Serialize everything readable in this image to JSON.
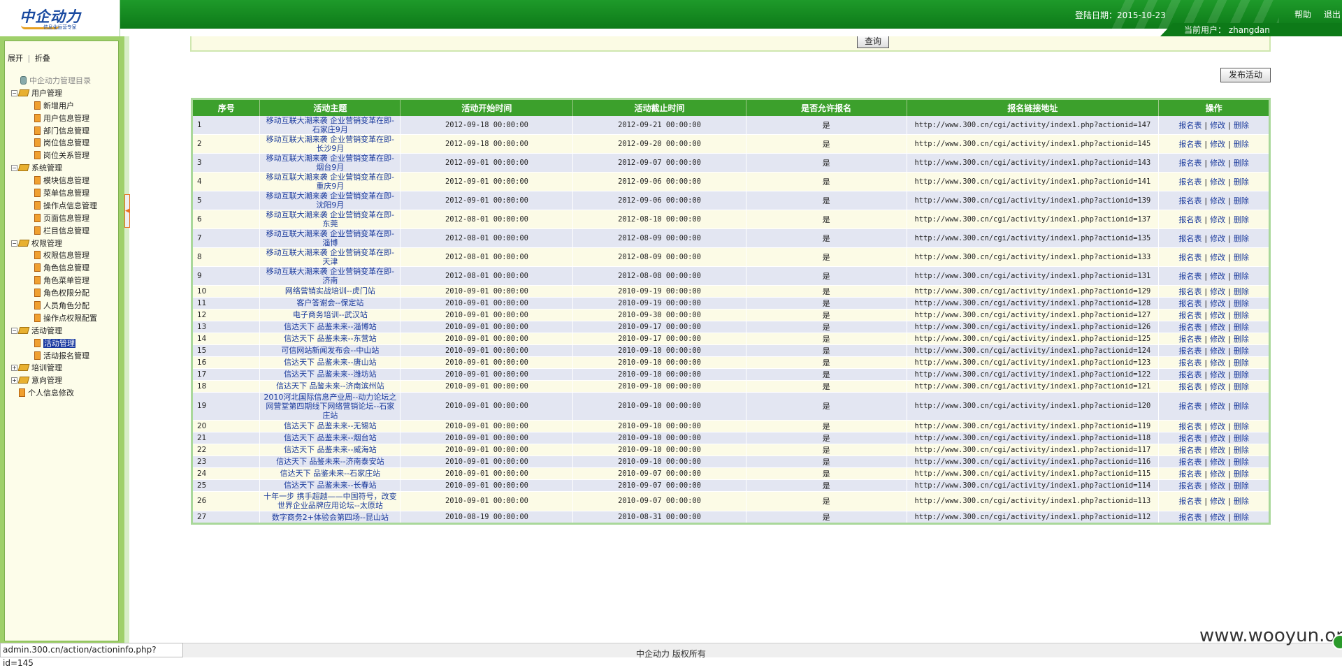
{
  "header": {
    "logo_text": "中企动力",
    "logo_sub": "信息化运营专家",
    "login_date": "登陆日期：2015-10-23",
    "current_user": "当前用户： zhangdan",
    "help": "帮助",
    "logout": "退出"
  },
  "sidebar": {
    "expand": "展开",
    "separator": "|",
    "collapse": "折叠",
    "root": "中企动力管理目录",
    "groups": [
      {
        "label": "用户管理",
        "items": [
          "新增用户",
          "用户信息管理",
          "部门信息管理",
          "岗位信息管理",
          "岗位关系管理"
        ]
      },
      {
        "label": "系统管理",
        "items": [
          "模块信息管理",
          "菜单信息管理",
          "操作点信息管理",
          "页面信息管理",
          "栏目信息管理"
        ]
      },
      {
        "label": "权限管理",
        "items": [
          "权限信息管理",
          "角色信息管理",
          "角色菜单管理",
          "角色权限分配",
          "人员角色分配",
          "操作点权限配置"
        ]
      },
      {
        "label": "活动管理",
        "items": [
          "活动管理",
          "活动报名管理"
        ]
      },
      {
        "label": "培训管理",
        "items": []
      },
      {
        "label": "意向管理",
        "items": []
      }
    ],
    "personal": "个人信息修改",
    "selected": "活动管理"
  },
  "toolbar": {
    "query": "查询",
    "publish": "发布活动"
  },
  "table": {
    "headers": [
      "序号",
      "活动主题",
      "活动开始时间",
      "活动截止时间",
      "是否允许报名",
      "报名链接地址",
      "操作"
    ],
    "op_labels": {
      "signup": "报名表",
      "edit": "修改",
      "delete": "删除",
      "sep": "|"
    },
    "rows": [
      {
        "seq": "1",
        "topic": "移动互联大潮来袭 企业营销变革在即-石家庄9月",
        "start": "2012-09-18 00:00:00",
        "end": "2012-09-21 00:00:00",
        "allow": "是",
        "url": "http://www.300.cn/cgi/activity/index1.php?actionid=147"
      },
      {
        "seq": "2",
        "topic": "移动互联大潮来袭 企业营销变革在即-长沙9月",
        "start": "2012-09-18 00:00:00",
        "end": "2012-09-20 00:00:00",
        "allow": "是",
        "url": "http://www.300.cn/cgi/activity/index1.php?actionid=145"
      },
      {
        "seq": "3",
        "topic": "移动互联大潮来袭 企业营销变革在即-烟台9月",
        "start": "2012-09-01 00:00:00",
        "end": "2012-09-07 00:00:00",
        "allow": "是",
        "url": "http://www.300.cn/cgi/activity/index1.php?actionid=143"
      },
      {
        "seq": "4",
        "topic": "移动互联大潮来袭 企业营销变革在即-重庆9月",
        "start": "2012-09-01 00:00:00",
        "end": "2012-09-06 00:00:00",
        "allow": "是",
        "url": "http://www.300.cn/cgi/activity/index1.php?actionid=141"
      },
      {
        "seq": "5",
        "topic": "移动互联大潮来袭 企业营销变革在即-沈阳9月",
        "start": "2012-09-01 00:00:00",
        "end": "2012-09-06 00:00:00",
        "allow": "是",
        "url": "http://www.300.cn/cgi/activity/index1.php?actionid=139"
      },
      {
        "seq": "6",
        "topic": "移动互联大潮来袭 企业营销变革在即-东莞",
        "start": "2012-08-01 00:00:00",
        "end": "2012-08-10 00:00:00",
        "allow": "是",
        "url": "http://www.300.cn/cgi/activity/index1.php?actionid=137"
      },
      {
        "seq": "7",
        "topic": "移动互联大潮来袭 企业营销变革在即-淄博",
        "start": "2012-08-01 00:00:00",
        "end": "2012-08-09 00:00:00",
        "allow": "是",
        "url": "http://www.300.cn/cgi/activity/index1.php?actionid=135"
      },
      {
        "seq": "8",
        "topic": "移动互联大潮来袭 企业营销变革在即-天津",
        "start": "2012-08-01 00:00:00",
        "end": "2012-08-09 00:00:00",
        "allow": "是",
        "url": "http://www.300.cn/cgi/activity/index1.php?actionid=133"
      },
      {
        "seq": "9",
        "topic": "移动互联大潮来袭 企业营销变革在即-济南",
        "start": "2012-08-01 00:00:00",
        "end": "2012-08-08 00:00:00",
        "allow": "是",
        "url": "http://www.300.cn/cgi/activity/index1.php?actionid=131"
      },
      {
        "seq": "10",
        "topic": "网络营销实战培训--虎门站",
        "start": "2010-09-01 00:00:00",
        "end": "2010-09-19 00:00:00",
        "allow": "是",
        "url": "http://www.300.cn/cgi/activity/index1.php?actionid=129"
      },
      {
        "seq": "11",
        "topic": "客户答谢会--保定站",
        "start": "2010-09-01 00:00:00",
        "end": "2010-09-19 00:00:00",
        "allow": "是",
        "url": "http://www.300.cn/cgi/activity/index1.php?actionid=128"
      },
      {
        "seq": "12",
        "topic": "电子商务培训--武汉站",
        "start": "2010-09-01 00:00:00",
        "end": "2010-09-30 00:00:00",
        "allow": "是",
        "url": "http://www.300.cn/cgi/activity/index1.php?actionid=127"
      },
      {
        "seq": "13",
        "topic": "信达天下 品鉴未来--淄博站",
        "start": "2010-09-01 00:00:00",
        "end": "2010-09-17 00:00:00",
        "allow": "是",
        "url": "http://www.300.cn/cgi/activity/index1.php?actionid=126"
      },
      {
        "seq": "14",
        "topic": "信达天下 品鉴未来--东营站",
        "start": "2010-09-01 00:00:00",
        "end": "2010-09-17 00:00:00",
        "allow": "是",
        "url": "http://www.300.cn/cgi/activity/index1.php?actionid=125"
      },
      {
        "seq": "15",
        "topic": "可信网站新闻发布会--中山站",
        "start": "2010-09-01 00:00:00",
        "end": "2010-09-10 00:00:00",
        "allow": "是",
        "url": "http://www.300.cn/cgi/activity/index1.php?actionid=124"
      },
      {
        "seq": "16",
        "topic": "信达天下 品鉴未来--唐山站",
        "start": "2010-09-01 00:00:00",
        "end": "2010-09-10 00:00:00",
        "allow": "是",
        "url": "http://www.300.cn/cgi/activity/index1.php?actionid=123"
      },
      {
        "seq": "17",
        "topic": "信达天下 品鉴未来--潍坊站",
        "start": "2010-09-01 00:00:00",
        "end": "2010-09-10 00:00:00",
        "allow": "是",
        "url": "http://www.300.cn/cgi/activity/index1.php?actionid=122"
      },
      {
        "seq": "18",
        "topic": "信达天下 品鉴未来--济南滨州站",
        "start": "2010-09-01 00:00:00",
        "end": "2010-09-10 00:00:00",
        "allow": "是",
        "url": "http://www.300.cn/cgi/activity/index1.php?actionid=121"
      },
      {
        "seq": "19",
        "topic": "2010河北国际信息产业周--动力论坛之网营堂第四期线下网络营销论坛--石家庄站",
        "start": "2010-09-01 00:00:00",
        "end": "2010-09-10 00:00:00",
        "allow": "是",
        "url": "http://www.300.cn/cgi/activity/index1.php?actionid=120"
      },
      {
        "seq": "20",
        "topic": "信达天下 品鉴未来--无锡站",
        "start": "2010-09-01 00:00:00",
        "end": "2010-09-10 00:00:00",
        "allow": "是",
        "url": "http://www.300.cn/cgi/activity/index1.php?actionid=119"
      },
      {
        "seq": "21",
        "topic": "信达天下 品鉴未来--烟台站",
        "start": "2010-09-01 00:00:00",
        "end": "2010-09-10 00:00:00",
        "allow": "是",
        "url": "http://www.300.cn/cgi/activity/index1.php?actionid=118"
      },
      {
        "seq": "22",
        "topic": "信达天下 品鉴未来--威海站",
        "start": "2010-09-01 00:00:00",
        "end": "2010-09-10 00:00:00",
        "allow": "是",
        "url": "http://www.300.cn/cgi/activity/index1.php?actionid=117"
      },
      {
        "seq": "23",
        "topic": "信达天下 品鉴未来--济南泰安站",
        "start": "2010-09-01 00:00:00",
        "end": "2010-09-10 00:00:00",
        "allow": "是",
        "url": "http://www.300.cn/cgi/activity/index1.php?actionid=116"
      },
      {
        "seq": "24",
        "topic": "信达天下 品鉴未来--石家庄站",
        "start": "2010-09-01 00:00:00",
        "end": "2010-09-07 00:00:00",
        "allow": "是",
        "url": "http://www.300.cn/cgi/activity/index1.php?actionid=115"
      },
      {
        "seq": "25",
        "topic": "信达天下 品鉴未来--长春站",
        "start": "2010-09-01 00:00:00",
        "end": "2010-09-07 00:00:00",
        "allow": "是",
        "url": "http://www.300.cn/cgi/activity/index1.php?actionid=114"
      },
      {
        "seq": "26",
        "topic": "十年一步 携手超越——中国符号，改变世界企业品牌应用论坛--太原站",
        "start": "2010-09-01 00:00:00",
        "end": "2010-09-07 00:00:00",
        "allow": "是",
        "url": "http://www.300.cn/cgi/activity/index1.php?actionid=113"
      },
      {
        "seq": "27",
        "topic": "数字商务2+体验会第四场--昆山站",
        "start": "2010-08-19 00:00:00",
        "end": "2010-08-31 00:00:00",
        "allow": "是",
        "url": "http://www.300.cn/cgi/activity/index1.php?actionid=112"
      }
    ]
  },
  "statusbar": {
    "url": "admin.300.cn/action/actioninfo.php?id=145",
    "copyright": "中企动力 版权所有",
    "watermark": "www.wooyun.org"
  }
}
